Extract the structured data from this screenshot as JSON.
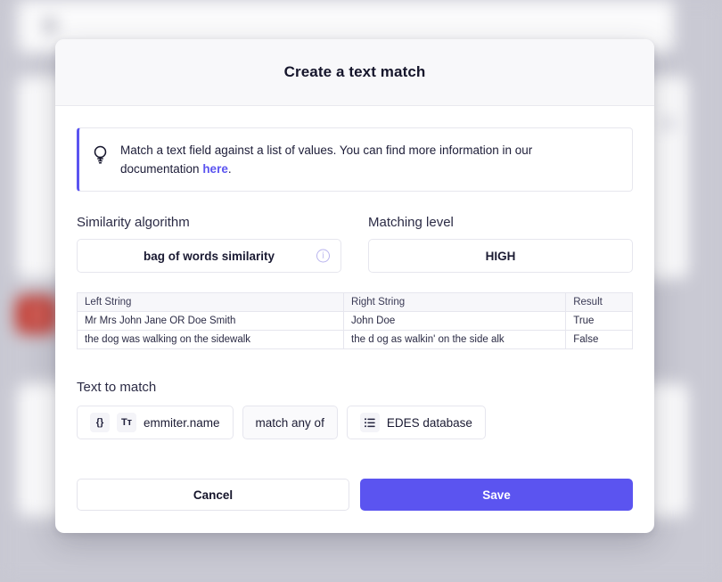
{
  "background": {
    "red_badge_color": "#c03127",
    "overlay_color": "#c8c8d2"
  },
  "modal": {
    "title": "Create a text match",
    "info": {
      "icon": "lightbulb-icon",
      "text_before": "Match a text field against a list of values. You can find more information in our documentation ",
      "link_label": "here",
      "text_after": "."
    },
    "fields": {
      "similarity": {
        "label": "Similarity algorithm",
        "value": "bag of words similarity",
        "info_icon": "info-circle-icon"
      },
      "matching_level": {
        "label": "Matching level",
        "value": "HIGH"
      }
    },
    "table": {
      "headers": [
        "Left String",
        "Right String",
        "Result"
      ],
      "rows": [
        [
          "Mr Mrs John Jane OR Doe Smith",
          "John Doe",
          "True"
        ],
        [
          "the dog was walking on the sidewalk",
          "the d og as walkin' on the side alk",
          "False"
        ]
      ]
    },
    "text_to_match": {
      "label": "Text to match",
      "field_chip": {
        "braces_icon": "{}",
        "type_icon": "Tт",
        "value": "emmiter.name"
      },
      "operator_chip": {
        "value": "match any of"
      },
      "source_chip": {
        "list_icon": "list-icon",
        "value": "EDES database"
      }
    },
    "footer": {
      "cancel_label": "Cancel",
      "save_label": "Save",
      "save_color": "#5b54f0"
    }
  }
}
